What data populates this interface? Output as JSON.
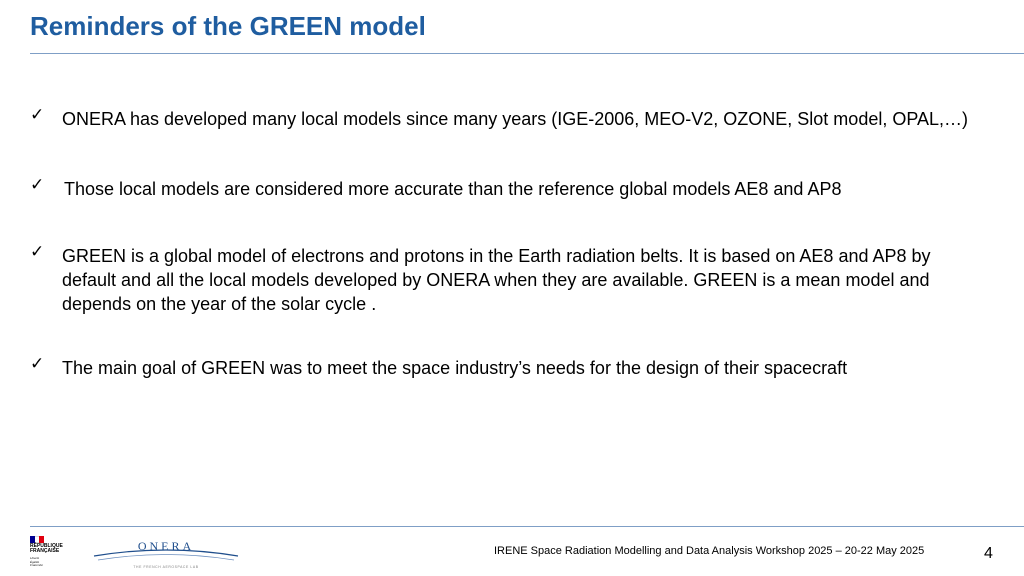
{
  "slide": {
    "title": "Reminders of the GREEN model",
    "bullet_icon": "check-mark-icon",
    "bullets": [
      "ONERA has developed many local models since many years (IGE-2006, MEO-V2, OZONE, Slot model, OPAL,…)",
      "Those local models are considered more accurate than the reference global models AE8 and AP8",
      "GREEN is a global model of electrons and protons in the Earth radiation belts. It is based on AE8 and AP8 by default and all the local models developed by ONERA when they are available. GREEN is a mean model and depends on the year of the solar cycle .",
      "The main goal of GREEN was to meet the space industry’s needs for the design of their spacecraft"
    ]
  },
  "footer": {
    "republique_logo": {
      "line1": "RÉPUBLIQUE",
      "line2": "FRANÇAISE",
      "motto1": "Liberté",
      "motto2": "Égalité",
      "motto3": "Fraternité"
    },
    "onera_logo": {
      "wordmark": "ONERA",
      "tagline": "THE FRENCH AEROSPACE LAB"
    },
    "event_text": "IRENE Space Radiation Modelling and Data Analysis Workshop 2025 – 20-22 May 2025",
    "page_number": "4"
  },
  "colors": {
    "title": "#1f5da0",
    "rule": "#7f9fc6",
    "flag_blue": "#000091",
    "flag_white": "#ffffff",
    "flag_red": "#e1000f",
    "onera_blue": "#1f4e8c"
  }
}
